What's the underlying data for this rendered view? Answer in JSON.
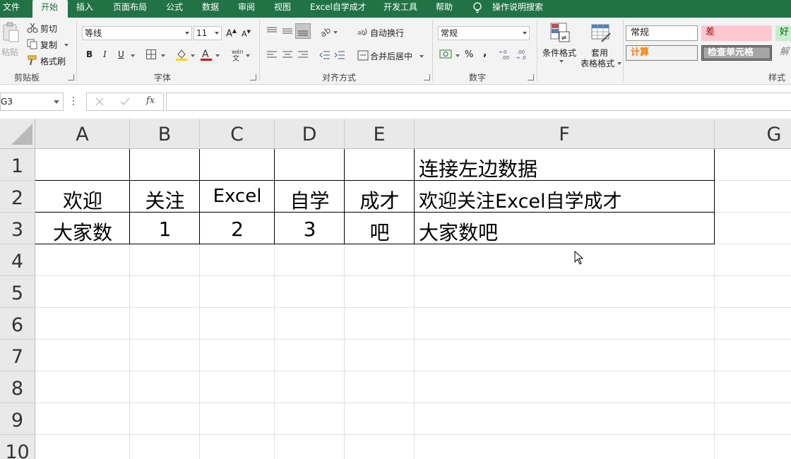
{
  "menu": {
    "tabs": [
      "文件",
      "开始",
      "插入",
      "页面布局",
      "公式",
      "数据",
      "审阅",
      "视图",
      "Excel自学成才",
      "开发工具",
      "帮助"
    ],
    "search": "操作说明搜索"
  },
  "ribbon": {
    "clipboard": {
      "paste": "粘贴",
      "cut": "剪切",
      "copy": "复制",
      "format_painter": "格式刷",
      "label": "剪贴板"
    },
    "font": {
      "name": "等线",
      "size": "11",
      "bold": "B",
      "italic": "I",
      "underline": "U",
      "label": "字体"
    },
    "align": {
      "wrap": "自动换行",
      "merge": "合并后居中",
      "label": "对齐方式"
    },
    "number": {
      "format": "常规",
      "percent": "%",
      "comma": ",",
      "label": "数字"
    },
    "styles": {
      "conditional": "条件格式",
      "table_line1": "套用",
      "table_line2": "表格格式",
      "normal": "常规",
      "bad": "差",
      "good": "好",
      "calc": "计算",
      "check": "检查单元格",
      "explain": "解",
      "label": "样式"
    }
  },
  "formula_bar": {
    "name_box": "G3",
    "formula": ""
  },
  "grid": {
    "columns": [
      "A",
      "B",
      "C",
      "D",
      "E",
      "F",
      "G"
    ],
    "rows": [
      "1",
      "2",
      "3",
      "4",
      "5",
      "6",
      "7",
      "8",
      "9",
      "10"
    ],
    "cells": {
      "F1": "连接左边数据",
      "A2": "欢迎",
      "B2": "关注",
      "C2": "Excel",
      "D2": "自学",
      "E2": "成才",
      "F2": "欢迎关注Excel自学成才",
      "A3": "大家数",
      "B3": "1",
      "C3": "2",
      "D3": "3",
      "E3": "吧",
      "F3": "大家数吧"
    }
  },
  "colors": {
    "brand": "#217346",
    "bad_fill": "#ffc7ce",
    "good_fill": "#c6efce",
    "calc_text": "#fa7d00"
  }
}
